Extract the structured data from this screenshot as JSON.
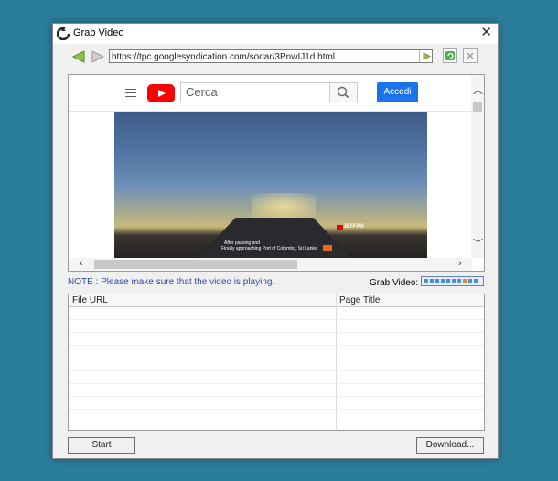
{
  "window": {
    "title": "Grab Video"
  },
  "toolbar": {
    "url": "https://tpc.googlesyndication.com/sodar/3PnwIJ1d.html"
  },
  "youtube": {
    "search_placeholder": "Cerca",
    "signin_label": "Accedi"
  },
  "video": {
    "caption_line1": "After passing                    and",
    "caption_line2": "Finally approaching Port of Colombo, Sri Lanka",
    "brand": "JEFFHK"
  },
  "status": {
    "note": "NOTE : Please make sure that the video is playing.",
    "grab_label": "Grab Video:"
  },
  "table": {
    "columns": [
      "File URL",
      "Page Title"
    ]
  },
  "buttons": {
    "start": "Start",
    "download": "Download..."
  },
  "colors": {
    "desktop": "#2b7d9c",
    "accent": "#1a73e8",
    "note_text": "#2d4aa8",
    "yt_red": "#ff0000"
  }
}
